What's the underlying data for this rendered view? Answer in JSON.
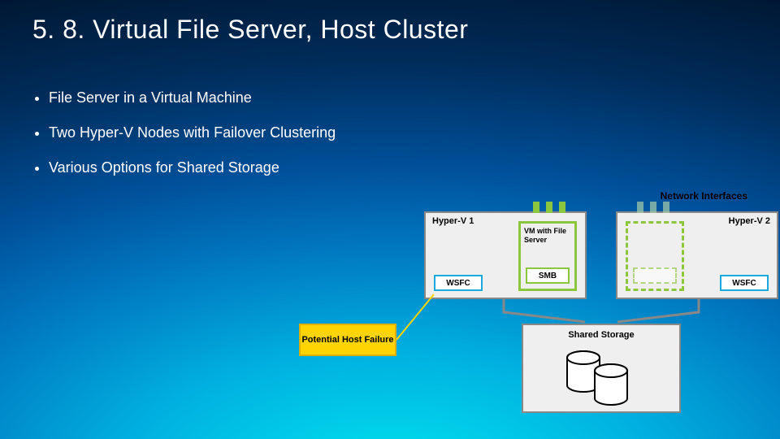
{
  "title": "5. 8. Virtual File Server, Host Cluster",
  "bullets": {
    "b1": "File Server in a Virtual Machine",
    "b2": "Two Hyper-V Nodes with Failover Clustering",
    "b3": "Various Options for Shared Storage"
  },
  "labels": {
    "network_interfaces": "Network Interfaces",
    "hyperv1": "Hyper-V 1",
    "hyperv2": "Hyper-V 2",
    "wsfc": "WSFC",
    "vm_title": "VM with File Server",
    "smb": "SMB",
    "potential_host_failure": "Potential Host Failure",
    "shared_storage": "Shared Storage"
  }
}
